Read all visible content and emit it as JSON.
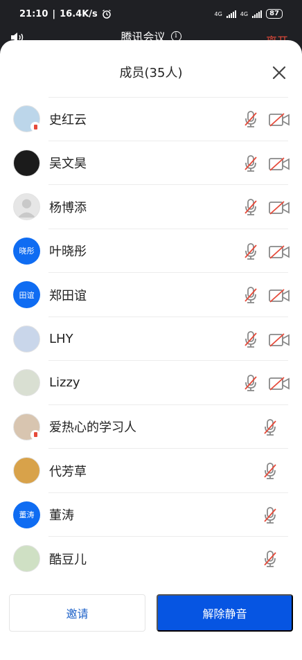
{
  "status_bar": {
    "time": "21:10",
    "speed": "16.4K/s",
    "network1": "4G",
    "network2": "4G",
    "battery": "87"
  },
  "meeting": {
    "title": "腾讯会议",
    "leave_label": "离开"
  },
  "sheet": {
    "title": "成员(35人)"
  },
  "members": [
    {
      "name": "史红云",
      "avatar_text": "",
      "avatar_type": "photo",
      "avatar_color": "#bcd6ea",
      "badge": true,
      "show_cam": true
    },
    {
      "name": "吴文昊",
      "avatar_text": "",
      "avatar_type": "photo",
      "avatar_color": "#1b1b1b",
      "badge": false,
      "show_cam": true
    },
    {
      "name": "杨博添",
      "avatar_text": "",
      "avatar_type": "default",
      "avatar_color": "#e6e6e6",
      "badge": false,
      "show_cam": true
    },
    {
      "name": "叶晓彤",
      "avatar_text": "晓彤",
      "avatar_type": "text",
      "avatar_color": "#0f6cf2",
      "badge": false,
      "show_cam": true
    },
    {
      "name": "郑田谊",
      "avatar_text": "田谊",
      "avatar_type": "text",
      "avatar_color": "#0f6cf2",
      "badge": false,
      "show_cam": true
    },
    {
      "name": "LHY",
      "avatar_text": "",
      "avatar_type": "photo",
      "avatar_color": "#c9d6ea",
      "badge": false,
      "show_cam": true
    },
    {
      "name": "Lizzy",
      "avatar_text": "",
      "avatar_type": "photo",
      "avatar_color": "#d9dfd2",
      "badge": false,
      "show_cam": true
    },
    {
      "name": "爱热心的学习人",
      "avatar_text": "",
      "avatar_type": "photo",
      "avatar_color": "#d8c5b0",
      "badge": true,
      "show_cam": false
    },
    {
      "name": "代芳草",
      "avatar_text": "",
      "avatar_type": "photo",
      "avatar_color": "#d8a24a",
      "badge": false,
      "show_cam": false
    },
    {
      "name": "董涛",
      "avatar_text": "董涛",
      "avatar_type": "text",
      "avatar_color": "#0f6cf2",
      "badge": false,
      "show_cam": false
    },
    {
      "name": "酷豆儿",
      "avatar_text": "",
      "avatar_type": "photo",
      "avatar_color": "#cfe0c4",
      "badge": false,
      "show_cam": false
    }
  ],
  "footer": {
    "invite_label": "邀请",
    "unmute_label": "解除静音"
  },
  "colors": {
    "accent": "#0655e2",
    "danger": "#e64a3a",
    "muted_icon": "#888888"
  }
}
